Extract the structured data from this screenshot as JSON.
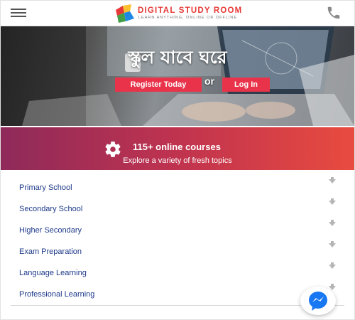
{
  "header": {
    "logo_title": "DIGITAL STUDY ROOM",
    "logo_tagline": "LEARN ANYTHING, ONLINE OR OFFLINE",
    "menu_icon": "hamburger-icon",
    "phone_icon": "phone-icon"
  },
  "hero": {
    "title": "স্কুল যাবে ঘরে",
    "register_label": "Register Today",
    "or_label": "or",
    "login_label": "Log In"
  },
  "banner": {
    "icon": "gear-icon",
    "title": "115+ online courses",
    "subtitle": "Explore a variety of fresh topics"
  },
  "courses": [
    {
      "label": "Primary School"
    },
    {
      "label": "Secondary School"
    },
    {
      "label": "Higher Secondary"
    },
    {
      "label": "Exam Preparation"
    },
    {
      "label": "Language Learning"
    },
    {
      "label": "Professional Learning"
    }
  ],
  "messenger": {
    "icon": "messenger-icon"
  },
  "colors": {
    "accent": "#e8334a",
    "link": "#1e3a8a",
    "banner_start": "#8e2a5a",
    "banner_end": "#e84b3f",
    "messenger": "#1877f2"
  }
}
